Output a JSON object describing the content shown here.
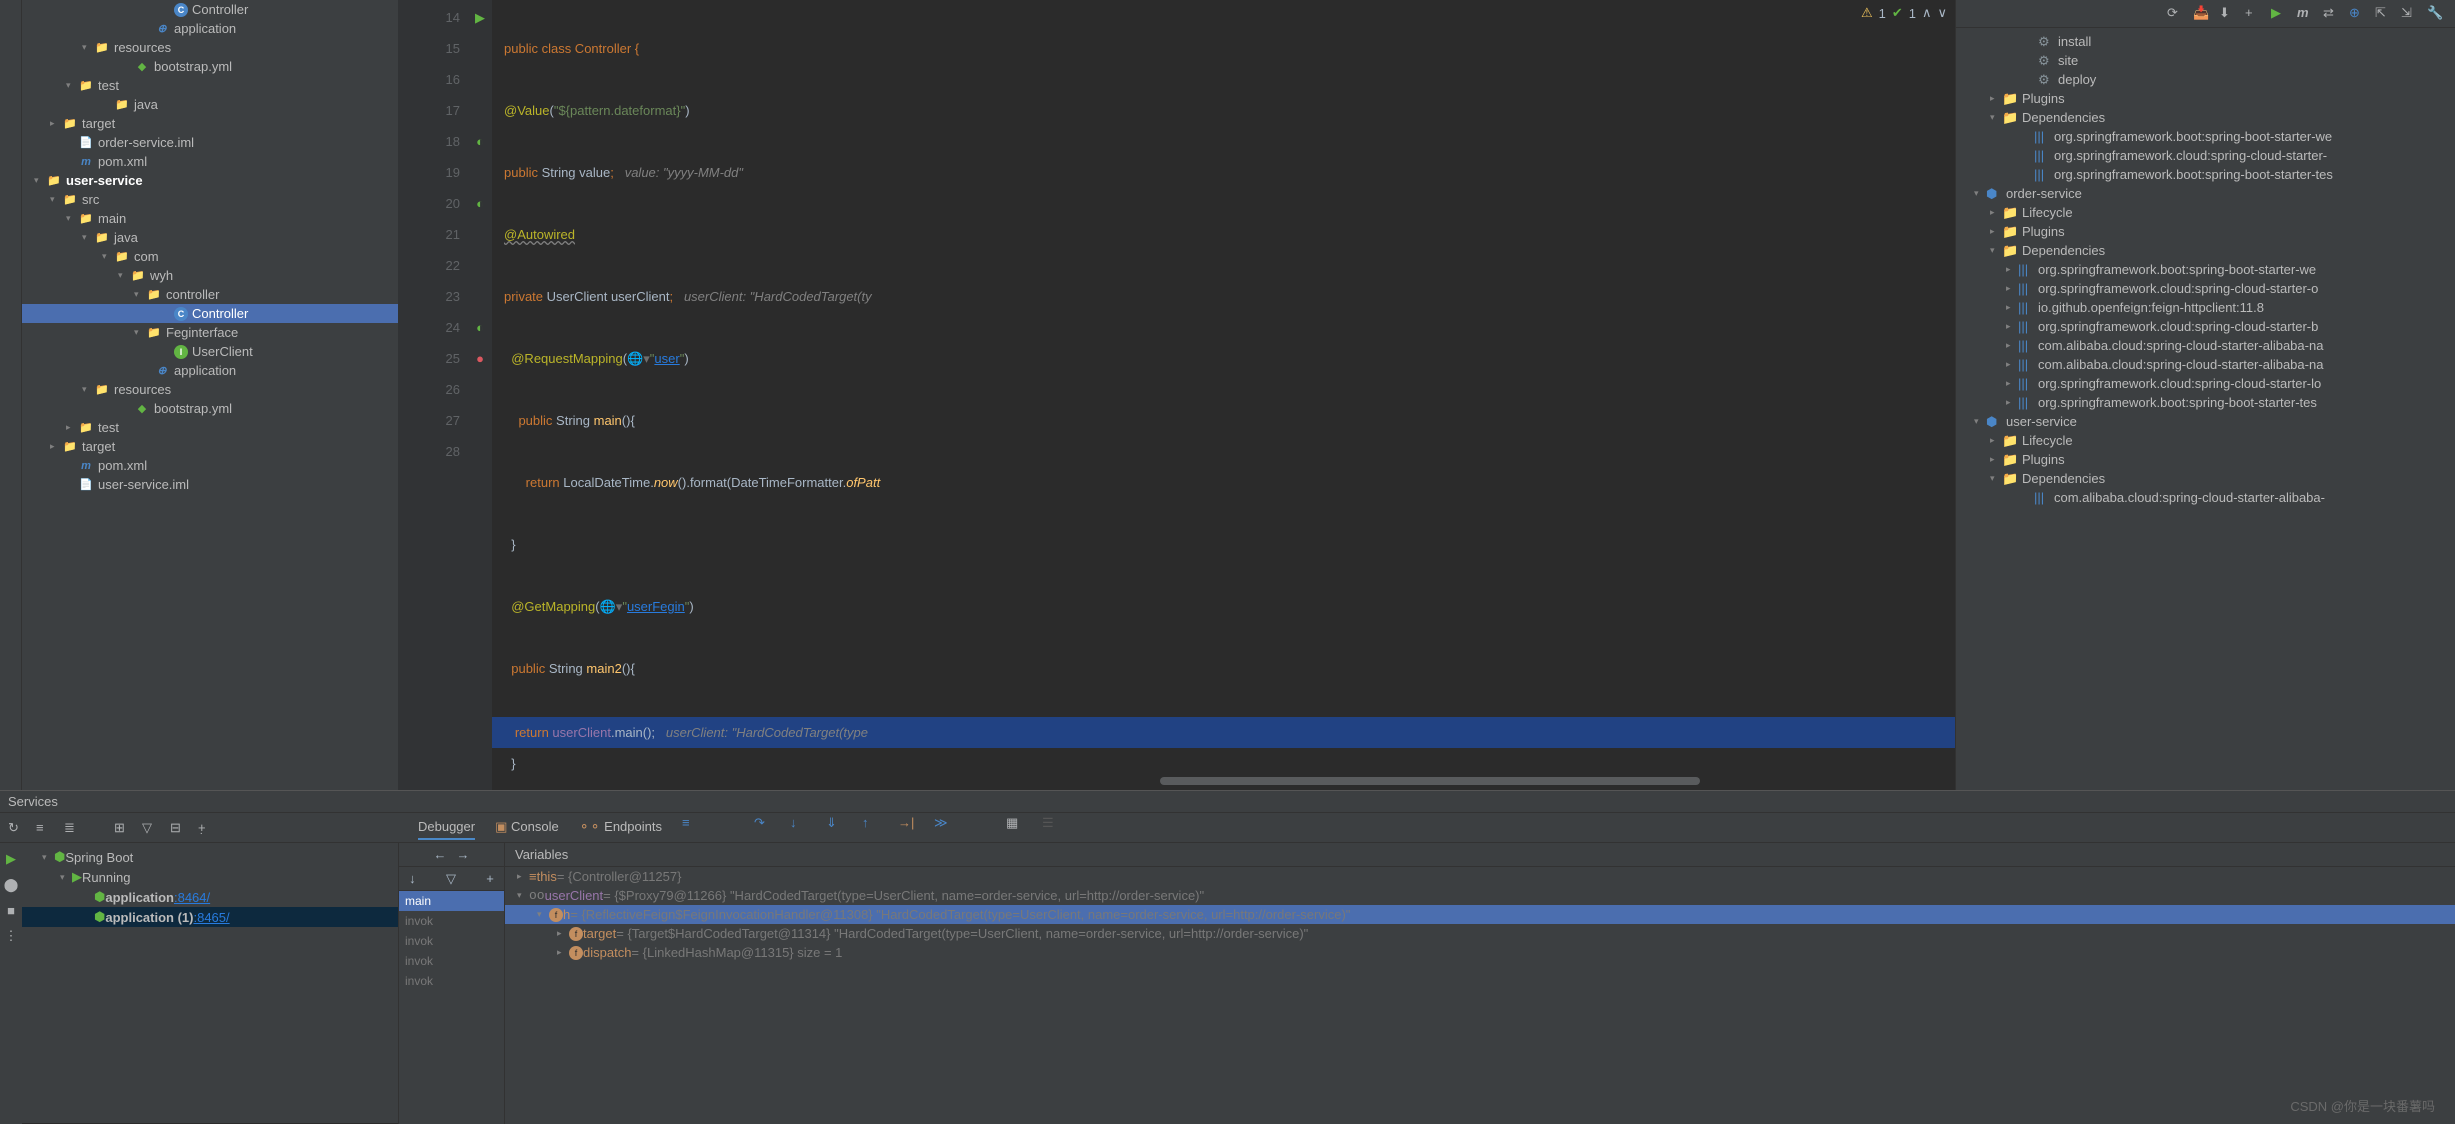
{
  "project_tree": {
    "items": [
      {
        "indent": 140,
        "arrow": "",
        "icon": "C",
        "iconClass": "class-icon",
        "label": "Controller"
      },
      {
        "indent": 120,
        "arrow": "",
        "icon": "⊕",
        "iconClass": "maven-icon",
        "label": "application",
        "color": "#62b543"
      },
      {
        "indent": 60,
        "arrow": "▾",
        "icon": "📁",
        "iconClass": "folder-icon",
        "label": "resources"
      },
      {
        "indent": 100,
        "arrow": "",
        "icon": "◆",
        "iconClass": "yml-icon",
        "label": "bootstrap.yml"
      },
      {
        "indent": 44,
        "arrow": "▾",
        "icon": "📁",
        "iconClass": "folder-icon",
        "label": "test"
      },
      {
        "indent": 80,
        "arrow": "",
        "icon": "📁",
        "iconClass": "folder-green",
        "label": "java"
      },
      {
        "indent": 28,
        "arrow": "▸",
        "icon": "📁",
        "iconClass": "folder-orange",
        "label": "target"
      },
      {
        "indent": 44,
        "arrow": "",
        "icon": "📄",
        "iconClass": "folder-icon",
        "label": "order-service.iml"
      },
      {
        "indent": 44,
        "arrow": "",
        "icon": "m",
        "iconClass": "maven-icon",
        "label": "pom.xml"
      },
      {
        "indent": 12,
        "arrow": "▾",
        "icon": "📁",
        "iconClass": "folder-blue",
        "label": "user-service",
        "bold": true
      },
      {
        "indent": 28,
        "arrow": "▾",
        "icon": "📁",
        "iconClass": "folder-icon",
        "label": "src"
      },
      {
        "indent": 44,
        "arrow": "▾",
        "icon": "📁",
        "iconClass": "folder-icon",
        "label": "main"
      },
      {
        "indent": 60,
        "arrow": "▾",
        "icon": "📁",
        "iconClass": "folder-blue",
        "label": "java"
      },
      {
        "indent": 80,
        "arrow": "▾",
        "icon": "📁",
        "iconClass": "folder-icon",
        "label": "com"
      },
      {
        "indent": 96,
        "arrow": "▾",
        "icon": "📁",
        "iconClass": "folder-icon",
        "label": "wyh"
      },
      {
        "indent": 112,
        "arrow": "▾",
        "icon": "📁",
        "iconClass": "folder-icon",
        "label": "controller"
      },
      {
        "indent": 140,
        "arrow": "",
        "icon": "C",
        "iconClass": "class-icon",
        "label": "Controller",
        "selected": true
      },
      {
        "indent": 112,
        "arrow": "▾",
        "icon": "📁",
        "iconClass": "folder-icon",
        "label": "Feginterface"
      },
      {
        "indent": 140,
        "arrow": "",
        "icon": "I",
        "iconClass": "interface-icon",
        "label": "UserClient"
      },
      {
        "indent": 120,
        "arrow": "",
        "icon": "⊕",
        "iconClass": "maven-icon",
        "label": "application",
        "color": "#62b543"
      },
      {
        "indent": 60,
        "arrow": "▾",
        "icon": "📁",
        "iconClass": "folder-icon",
        "label": "resources"
      },
      {
        "indent": 100,
        "arrow": "",
        "icon": "◆",
        "iconClass": "yml-icon",
        "label": "bootstrap.yml"
      },
      {
        "indent": 44,
        "arrow": "▸",
        "icon": "📁",
        "iconClass": "folder-icon",
        "label": "test"
      },
      {
        "indent": 28,
        "arrow": "▸",
        "icon": "📁",
        "iconClass": "folder-orange",
        "label": "target"
      },
      {
        "indent": 44,
        "arrow": "",
        "icon": "m",
        "iconClass": "maven-icon",
        "label": "pom.xml"
      },
      {
        "indent": 44,
        "arrow": "",
        "icon": "📄",
        "iconClass": "folder-icon",
        "label": "user-service.iml"
      }
    ]
  },
  "editor": {
    "inspections": {
      "warn": "1",
      "ok": "1"
    },
    "lines": [
      14,
      15,
      16,
      17,
      18,
      19,
      20,
      21,
      22,
      23,
      24,
      25,
      26,
      27,
      28
    ],
    "code": {
      "l14": "public class Controller {",
      "l15a": "@Value",
      "l15b": "(",
      "l15c": "\"${pattern.dateformat}\"",
      "l15d": ")",
      "l16a": "public ",
      "l16b": "String ",
      "l16c": "value",
      "l16d": ";",
      "l16e": "value: \"yyyy-MM-dd\"",
      "l17": "@Autowired",
      "l18a": "private ",
      "l18b": "UserClient ",
      "l18c": "userClient",
      "l18d": ";",
      "l18e": "userClient: \"HardCodedTarget(ty",
      "l19a": "@RequestMapping",
      "l19b": "(",
      "l19c": "\"",
      "l19d": "user",
      "l19e": "\"",
      "l19f": ")",
      "l20a": "public ",
      "l20b": "String ",
      "l20c": "main",
      "l20d": "(){",
      "l21a": "return ",
      "l21b": "LocalDateTime.",
      "l21c": "now",
      "l21d": "().format(DateTimeFormatter.",
      "l21e": "ofPatt",
      "l22": "}",
      "l23a": "@GetMapping",
      "l23b": "(",
      "l23c": "\"",
      "l23d": "userFegin",
      "l23e": "\"",
      "l23f": ")",
      "l24a": "public ",
      "l24b": "String ",
      "l24c": "main2",
      "l24d": "(){",
      "l25a": "return ",
      "l25b": "userClient",
      "l25c": ".main();",
      "l25d": "userClient: \"HardCodedTarget(type",
      "l26": "}",
      "l27": "}"
    }
  },
  "maven_panel": {
    "items": [
      {
        "indent": 60,
        "arrow": "",
        "icon": "⚙",
        "label": "install"
      },
      {
        "indent": 60,
        "arrow": "",
        "icon": "⚙",
        "label": "site"
      },
      {
        "indent": 60,
        "arrow": "",
        "icon": "⚙",
        "label": "deploy"
      },
      {
        "indent": 24,
        "arrow": "▸",
        "icon": "📁",
        "label": "Plugins"
      },
      {
        "indent": 24,
        "arrow": "▾",
        "icon": "📁",
        "label": "Dependencies"
      },
      {
        "indent": 56,
        "arrow": "",
        "icon": "|||",
        "label": "org.springframework.boot:spring-boot-starter-we"
      },
      {
        "indent": 56,
        "arrow": "",
        "icon": "|||",
        "label": "org.springframework.cloud:spring-cloud-starter-"
      },
      {
        "indent": 56,
        "arrow": "",
        "icon": "|||",
        "label": "org.springframework.boot:spring-boot-starter-tes"
      },
      {
        "indent": 8,
        "arrow": "▾",
        "icon": "⬢",
        "label": "order-service"
      },
      {
        "indent": 24,
        "arrow": "▸",
        "icon": "📁",
        "label": "Lifecycle"
      },
      {
        "indent": 24,
        "arrow": "▸",
        "icon": "📁",
        "label": "Plugins"
      },
      {
        "indent": 24,
        "arrow": "▾",
        "icon": "📁",
        "label": "Dependencies"
      },
      {
        "indent": 40,
        "arrow": "▸",
        "icon": "|||",
        "label": "org.springframework.boot:spring-boot-starter-we"
      },
      {
        "indent": 40,
        "arrow": "▸",
        "icon": "|||",
        "label": "org.springframework.cloud:spring-cloud-starter-o"
      },
      {
        "indent": 40,
        "arrow": "▸",
        "icon": "|||",
        "label": "io.github.openfeign:feign-httpclient:11.8"
      },
      {
        "indent": 40,
        "arrow": "▸",
        "icon": "|||",
        "label": "org.springframework.cloud:spring-cloud-starter-b"
      },
      {
        "indent": 40,
        "arrow": "▸",
        "icon": "|||",
        "label": "com.alibaba.cloud:spring-cloud-starter-alibaba-na"
      },
      {
        "indent": 40,
        "arrow": "▸",
        "icon": "|||",
        "label": "com.alibaba.cloud:spring-cloud-starter-alibaba-na"
      },
      {
        "indent": 40,
        "arrow": "▸",
        "icon": "|||",
        "label": "org.springframework.cloud:spring-cloud-starter-lo"
      },
      {
        "indent": 40,
        "arrow": "▸",
        "icon": "|||",
        "label": "org.springframework.boot:spring-boot-starter-tes"
      },
      {
        "indent": 8,
        "arrow": "▾",
        "icon": "⬢",
        "label": "user-service"
      },
      {
        "indent": 24,
        "arrow": "▸",
        "icon": "📁",
        "label": "Lifecycle"
      },
      {
        "indent": 24,
        "arrow": "▸",
        "icon": "📁",
        "label": "Plugins"
      },
      {
        "indent": 24,
        "arrow": "▾",
        "icon": "📁",
        "label": "Dependencies"
      },
      {
        "indent": 56,
        "arrow": "",
        "icon": "|||",
        "label": "com.alibaba.cloud:spring-cloud-starter-alibaba-"
      }
    ]
  },
  "services": {
    "title": "Services",
    "spring": "Spring Boot",
    "running": "Running",
    "app1": "application",
    "port1": ":8464/",
    "app2": "application (1)",
    "port2": ":8465/"
  },
  "debugger": {
    "tabs": {
      "debugger": "Debugger",
      "console": "Console",
      "endpoints": "Endpoints"
    },
    "frames": [
      "main",
      "invok",
      "invok",
      "invok",
      "invok"
    ],
    "vars_header": "Variables",
    "vars": [
      {
        "indent": 12,
        "arrow": "▸",
        "icon": "≡",
        "name": "this",
        "rest": " = {Controller@11257}"
      },
      {
        "indent": 12,
        "arrow": "▾",
        "icon": "oo",
        "name": "userClient",
        "rest": " = {$Proxy79@11266} \"HardCodedTarget(type=UserClient, name=order-service, url=http://order-service)\""
      },
      {
        "indent": 32,
        "arrow": "▾",
        "icon": "f",
        "name": "h",
        "rest": " = {ReflectiveFeign$FeignInvocationHandler@11308} \"HardCodedTarget(type=UserClient, name=order-service, url=http://order-service)\"",
        "selected": true
      },
      {
        "indent": 52,
        "arrow": "▸",
        "icon": "f",
        "name": "target",
        "rest": " = {Target$HardCodedTarget@11314} \"HardCodedTarget(type=UserClient, name=order-service, url=http://order-service)\""
      },
      {
        "indent": 52,
        "arrow": "▸",
        "icon": "f",
        "name": "dispatch",
        "rest": " = {LinkedHashMap@11315}  size = 1"
      }
    ]
  },
  "watermark": "CSDN @你是一块番薯吗"
}
